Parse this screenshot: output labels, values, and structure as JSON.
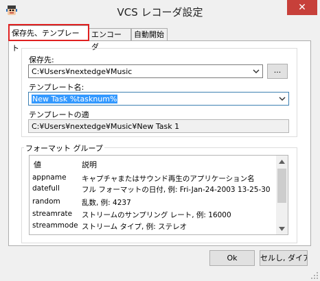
{
  "window": {
    "title": "VCS レコーダ設定",
    "close_glyph": "✕"
  },
  "tabs": [
    {
      "label": "保存先、テンプレート"
    },
    {
      "label": "エンコーダ"
    },
    {
      "label": "自動開始"
    }
  ],
  "save": {
    "label": "保存先:",
    "path_value": "C:¥Users¥nextedge¥Music",
    "browse_label": "..."
  },
  "template": {
    "label": "テンプレート名:",
    "value": "New Task %tasknum%"
  },
  "applied": {
    "label": "テンプレートの適",
    "value": "C:¥Users¥nextedge¥Music¥New Task 1"
  },
  "format_group": {
    "label": "フォーマット グループ",
    "columns": [
      "値",
      "説明"
    ],
    "rows": [
      {
        "value": "appname",
        "desc": "キャプチャまたはサウンド再生のアプリケーション名"
      },
      {
        "value": "datefull",
        "desc": "フル フォーマットの日付, 例: Fri-Jan-24-2003 13-25-30"
      },
      {
        "value": "random",
        "desc": "乱数, 例: 4237"
      },
      {
        "value": "streamrate",
        "desc": "ストリームのサンプリング レート, 例: 16000"
      },
      {
        "value": "streammode",
        "desc": "ストリーム タイプ, 例: ステレオ"
      }
    ]
  },
  "buttons": {
    "ok": "Ok",
    "cancel": "セルし, ダイア"
  }
}
